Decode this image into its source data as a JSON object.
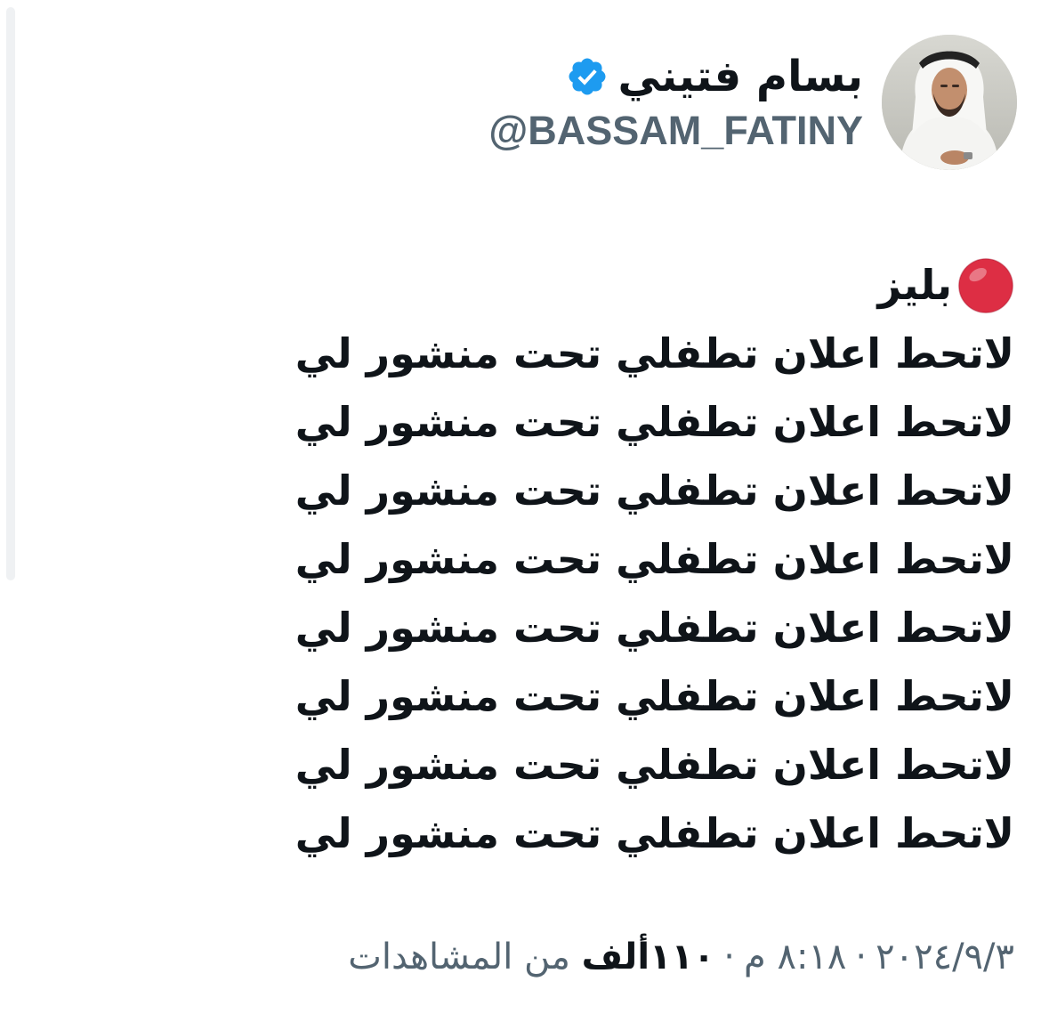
{
  "author": {
    "display_name": "بسام فتيني",
    "handle": "@BASSAM_FATINY",
    "verified": true,
    "verified_color": "#1d9bf0",
    "avatar_icon": "profile-photo"
  },
  "tweet": {
    "marker_icon": "red-circle-emoji",
    "marker_color": "#dd2e44",
    "first_line": "بليز",
    "lines": [
      "لاتحط اعلان تطفلي تحت منشور لي",
      "لاتحط اعلان تطفلي تحت منشور لي",
      "لاتحط اعلان تطفلي تحت منشور لي",
      "لاتحط اعلان تطفلي تحت منشور لي",
      "لاتحط اعلان تطفلي تحت منشور لي",
      "لاتحط اعلان تطفلي تحت منشور لي",
      "لاتحط اعلان تطفلي تحت منشور لي",
      "لاتحط اعلان تطفلي تحت منشور لي"
    ]
  },
  "meta": {
    "date": "٢٠٢٤/٩/٣",
    "time": "٨:١٨ م",
    "separator": "·",
    "views_count": "١١٠ألف",
    "views_label": "من المشاهدات"
  },
  "colors": {
    "text_primary": "#0f1419",
    "text_secondary": "#536471",
    "background": "#ffffff"
  }
}
